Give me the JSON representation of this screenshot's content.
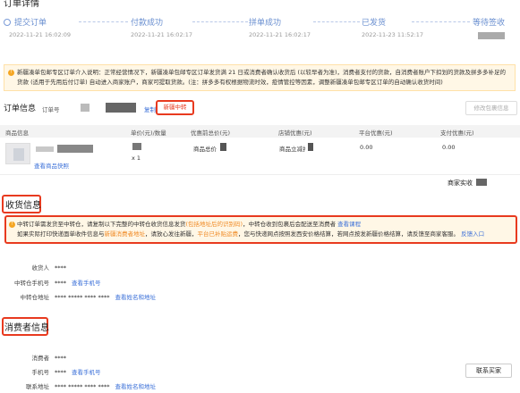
{
  "page": {
    "title": "订单详情"
  },
  "steps": [
    {
      "label": "提交订单",
      "time": "2022-11-21 16:02:09"
    },
    {
      "label": "付款成功",
      "time": "2022-11-21 16:02:17"
    },
    {
      "label": "拼单成功",
      "time": "2022-11-21 16:02:17"
    },
    {
      "label": "已发货",
      "time": "2022-11-23 11:52:17"
    },
    {
      "label": "等待签收",
      "time": ""
    }
  ],
  "notice": {
    "text": "新疆凑单包邮专区订单介入说明：正常经营情况下，新疆凑单包邮专区订单发货满 21 日或消费者确认收货后 (以较早者为准)，消费者支付的货款，自消费者账户下扣划的货款及拼多多补足的货款 (适用于先用后付订单) 自动进入商家账户，商家可提取货款。(注：拼多多有权根据物流时效，疫情管控等因素，调整新疆凑单包邮专区订单的自动确认收货时间)"
  },
  "order": {
    "title": "订单信息",
    "number_label": "订单号",
    "copy_label": "复制",
    "tag": "新疆中转",
    "edit_button": "修改包裹信息"
  },
  "table": {
    "headers": [
      "商品信息",
      "单价(元)/数量",
      "优惠前总价(元)",
      "店铺优惠(元)",
      "平台优惠(元)",
      "支付优惠(元)"
    ],
    "row": {
      "qty": "x 1",
      "snapshot_link": "查看商品快照",
      "total_label": "商品总价",
      "shop_discount_label": "商品立减扌",
      "platform_discount": "0.00",
      "pay_discount": "0.00"
    }
  },
  "seller": {
    "label": "商家实收"
  },
  "shipping": {
    "title": "收货信息",
    "warning_parts": [
      {
        "t": "中转订单需发货至中转仓，请复制以下完整的中转仓收货信息发货",
        "c": ""
      },
      {
        "t": "(包括地址后的识别码)",
        "c": "orange"
      },
      {
        "t": "，中转仓收到包裹后会配送至消费者 ",
        "c": ""
      },
      {
        "t": "查看课程",
        "c": "blue"
      },
      {
        "t": "如果实际打印快递面单收件信息与",
        "c": ""
      },
      {
        "t": "新疆消费者地址",
        "c": "orange"
      },
      {
        "t": "，请放心发往新疆，",
        "c": ""
      },
      {
        "t": "平台已补贴运费",
        "c": "orange"
      },
      {
        "t": "，您与快递网点按照发西安价格结算，若网点按发新疆价格结算，请反馈至商家客服。 ",
        "c": ""
      },
      {
        "t": "反馈入口",
        "c": "blue"
      }
    ],
    "receiver_label": "收货人",
    "receiver_value": "****",
    "phone_label": "中转仓手机号",
    "phone_value": "****",
    "phone_link": "查看手机号",
    "address_label": "中转仓地址",
    "address_value": "**** ***** **** ****",
    "address_link": "查看姓名和地址"
  },
  "consumer": {
    "title": "消费者信息",
    "name_label": "消费者",
    "name_value": "****",
    "phone_label": "手机号",
    "phone_value": "****",
    "phone_link": "查看手机号",
    "address_label": "联系地址",
    "address_value": "**** ***** **** ****",
    "address_link": "查看姓名和地址",
    "contact_button": "联系买家"
  },
  "colors": {
    "highlight": "#e83a1f",
    "link": "#3a6fd8",
    "warning_bg": "#fff7e6",
    "orange": "#f08a24"
  }
}
